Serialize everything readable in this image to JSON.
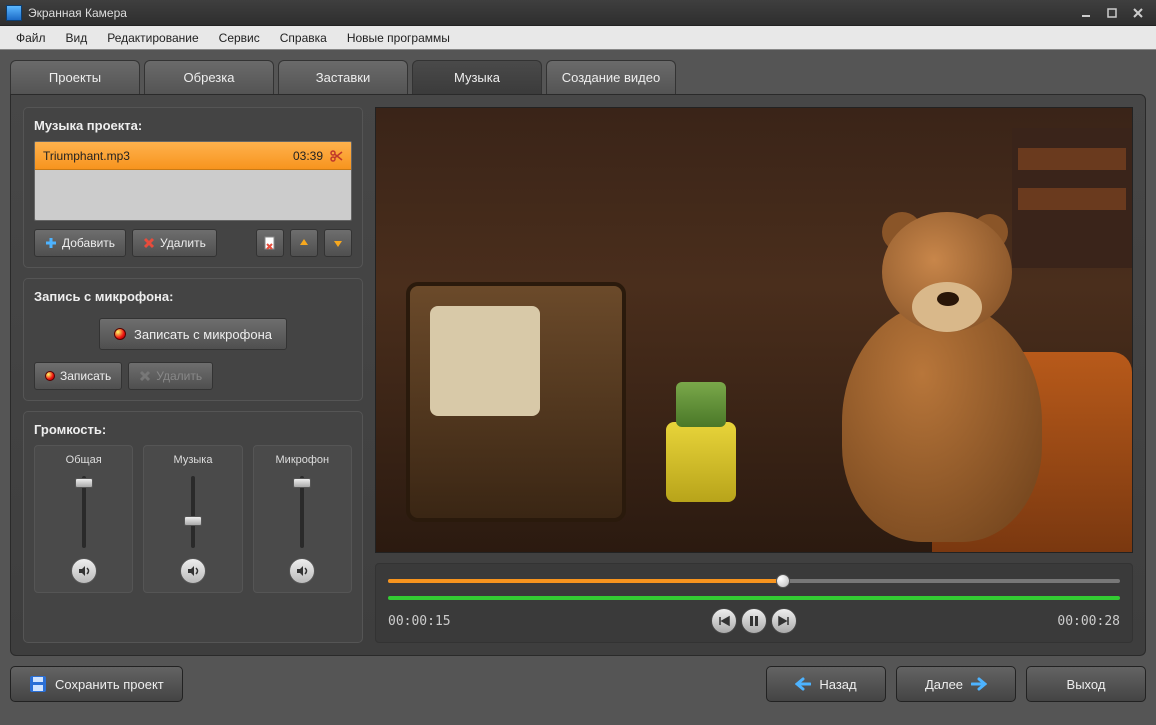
{
  "window": {
    "title": "Экранная Камера"
  },
  "menu": {
    "file": "Файл",
    "view": "Вид",
    "edit": "Редактирование",
    "service": "Сервис",
    "help": "Справка",
    "new_programs": "Новые программы"
  },
  "tabs": {
    "projects": "Проекты",
    "trim": "Обрезка",
    "intros": "Заставки",
    "music": "Музыка",
    "create_video": "Создание видео"
  },
  "music_panel": {
    "title": "Музыка проекта:",
    "tracks": [
      {
        "name": "Triumphant.mp3",
        "duration": "03:39"
      }
    ],
    "add": "Добавить",
    "delete": "Удалить"
  },
  "mic_panel": {
    "title": "Запись с микрофона:",
    "record_from_mic": "Записать с микрофона",
    "record": "Записать",
    "delete": "Удалить"
  },
  "volume_panel": {
    "title": "Громкость:",
    "overall": "Общая",
    "music": "Музыка",
    "mic": "Микрофон",
    "levels": {
      "overall": 88,
      "music": 40,
      "mic": 88
    }
  },
  "playback": {
    "current_time": "00:00:15",
    "total_time": "00:00:28",
    "progress_percent": 54
  },
  "footer": {
    "save_project": "Сохранить проект",
    "back": "Назад",
    "next": "Далее",
    "exit": "Выход"
  }
}
